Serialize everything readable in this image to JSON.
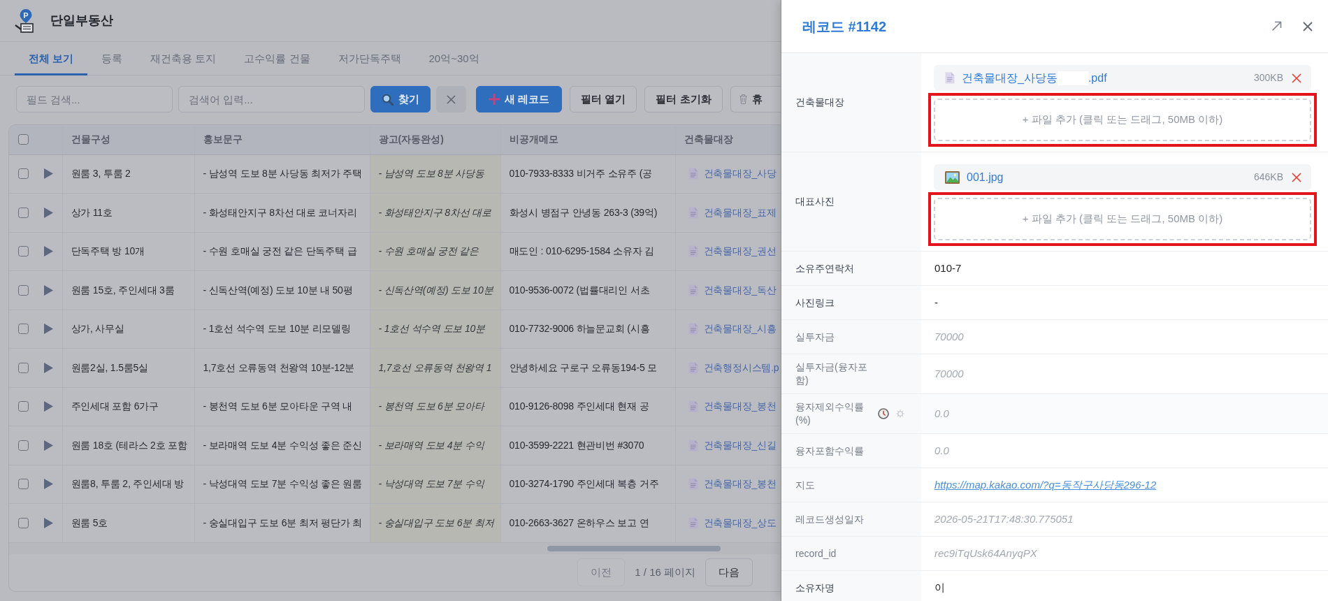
{
  "app": {
    "logo_letter": "P",
    "title": "단일부동산"
  },
  "tabs": [
    {
      "label": "전체 보기",
      "selected": true
    },
    {
      "label": "등록",
      "selected": false
    },
    {
      "label": "재건축용 토지",
      "selected": false
    },
    {
      "label": "고수익률 건물",
      "selected": false
    },
    {
      "label": "저가단독주택",
      "selected": false
    },
    {
      "label": "20억~30억",
      "selected": false
    }
  ],
  "toolbar": {
    "field_search": {
      "placeholder": "필드 검색..."
    },
    "search": {
      "placeholder": "검색어 입력..."
    },
    "buttons": [
      {
        "kind": "search",
        "label": "찾기"
      },
      {
        "kind": "clear"
      },
      {
        "kind": "new",
        "label": "새 레코드"
      },
      {
        "kind": "plain",
        "label": "필터 열기"
      },
      {
        "kind": "plain",
        "label": "필터 초기화"
      },
      {
        "kind": "trash",
        "label": "휴"
      }
    ]
  },
  "table": {
    "select_all": {
      "checked": false
    },
    "columns": [
      {
        "label": "건물구성",
        "kind": "text"
      },
      {
        "label": "홍보문구",
        "kind": "text"
      },
      {
        "label": "광고(자동완성)",
        "kind": "auto"
      },
      {
        "label": "비공개메모",
        "kind": "text"
      },
      {
        "label": "건축물대장",
        "kind": "file"
      }
    ],
    "rows": [
      {
        "checked": false,
        "expanded": false,
        "cells": [
          "원룸 3, 투룸 2",
          "- 남성역 도보 8분 사당동 최저가 주택",
          "- 남성역 도보 8분 사당동",
          "010-7933-8333 비거주 소유주 (공",
          "건축물대장_사당"
        ]
      },
      {
        "checked": false,
        "expanded": false,
        "cells": [
          "상가 11호",
          "- 화성태안지구 8차선 대로 코너자리",
          "- 화성태안지구 8차선 대로",
          "화성시 병점구 안녕동 263-3 (39억)",
          "건축물대장_표제"
        ]
      },
      {
        "checked": false,
        "expanded": false,
        "cells": [
          "단독주택 방 10개",
          "- 수원 호매실 궁전 같은 단독주택 급",
          "- 수원 호매실 궁전 같은",
          "매도인 : 010-6295-1584 소유자 김",
          "건축물대장_권선"
        ]
      },
      {
        "checked": false,
        "expanded": false,
        "cells": [
          "원룸 15호, 주인세대 3룸",
          "- 신독산역(예정) 도보 10분 내 50평",
          "- 신독산역(예정) 도보 10분",
          "010-9536-0072 (법률대리인 서초",
          "건축물대장_독산"
        ]
      },
      {
        "checked": false,
        "expanded": false,
        "cells": [
          "상가, 사무실",
          "- 1호선 석수역 도보 10분 리모델링",
          "- 1호선 석수역 도보 10분",
          "010-7732-9006 하늘문교회 (시흥",
          "건축물대장_시흥"
        ]
      },
      {
        "checked": false,
        "expanded": false,
        "cells": [
          "원룸2실, 1.5룸5실",
          "1,7호선 오류동역 천왕역 10분-12분",
          "1,7호선 오류동역 천왕역 1",
          "안녕하세요 구로구 오류동194-5 모",
          "건축행정시스템.p"
        ]
      },
      {
        "checked": false,
        "expanded": false,
        "cells": [
          "주인세대 포함 6가구",
          "- 봉천역 도보 6분 모아타운 구역 내",
          "- 봉천역 도보 6분 모아타",
          "010-9126-8098 주인세대 현재 공",
          "건축물대장_봉천"
        ]
      },
      {
        "checked": false,
        "expanded": false,
        "cells": [
          "원룸 18호 (테라스 2호 포함",
          "- 보라매역 도보 4분 수익성 좋은 준신",
          "- 보라매역 도보 4분 수익",
          "010-3599-2221 현관비번 #3070",
          "건축물대장_신길"
        ]
      },
      {
        "checked": false,
        "expanded": false,
        "cells": [
          "원룸8, 투룸 2, 주인세대 방",
          "- 낙성대역 도보 7분 수익성 좋은 원룸",
          "- 낙성대역 도보 7분 수익",
          "010-3274-1790 주인세대 복층 거주",
          "건축물대장_봉천"
        ]
      },
      {
        "checked": false,
        "expanded": false,
        "cells": [
          "원룸 5호",
          "- 숭실대입구 도보 6분 최저 평단가 최",
          "- 숭실대입구 도보 6분 최저",
          "010-2663-3627 온하우스 보고 연",
          "건축물대장_상도"
        ]
      }
    ]
  },
  "pagination": {
    "prev": {
      "label": "이전",
      "disabled": true
    },
    "info": "1 / 16 페이지",
    "next": {
      "label": "다음",
      "disabled": false
    }
  },
  "drawer": {
    "title": "레코드 #1142",
    "fields": [
      {
        "label": "건축물대장",
        "kind": "file",
        "files": [
          {
            "kind": "document",
            "name_parts": [
              "건축물대장_사당동",
              ".pdf"
            ],
            "size": "300KB"
          }
        ],
        "dropzone": {
          "label": "+ 파일 추가 (클릭 또는 드래그, 50MB 이하)",
          "highlighted": true
        }
      },
      {
        "label": "대표사진",
        "kind": "file",
        "files": [
          {
            "kind": "image",
            "name_parts": [
              "001.jpg"
            ],
            "size": "646KB"
          }
        ],
        "dropzone": {
          "label": "+ 파일 추가 (클릭 또는 드래그, 50MB 이하)",
          "highlighted": true
        }
      },
      {
        "label": "소유주연락처",
        "kind": "text",
        "value": "010-7"
      },
      {
        "label": "사진링크",
        "kind": "text",
        "value": "-"
      },
      {
        "label": "실투자금",
        "kind": "computed",
        "value": "70000"
      },
      {
        "label": "실투자금(융자포함)",
        "kind": "computed",
        "value": "70000"
      },
      {
        "label": "융자제외수익률 (%)",
        "kind": "computed",
        "value": "0.0",
        "hovered": true
      },
      {
        "label": "융자포함수익률",
        "kind": "computed",
        "value": "0.0"
      },
      {
        "label": "지도",
        "kind": "link",
        "value": "https://map.kakao.com/?q=동작구사당동296-12"
      },
      {
        "label": "레코드생성일자",
        "kind": "computed",
        "value": "2026-05-21T17:48:30.775051"
      },
      {
        "label": "record_id",
        "kind": "computed",
        "value": "rec9iTqUsk64AnyqPX"
      },
      {
        "label": "소유자명",
        "kind": "text",
        "value": "이"
      }
    ]
  }
}
